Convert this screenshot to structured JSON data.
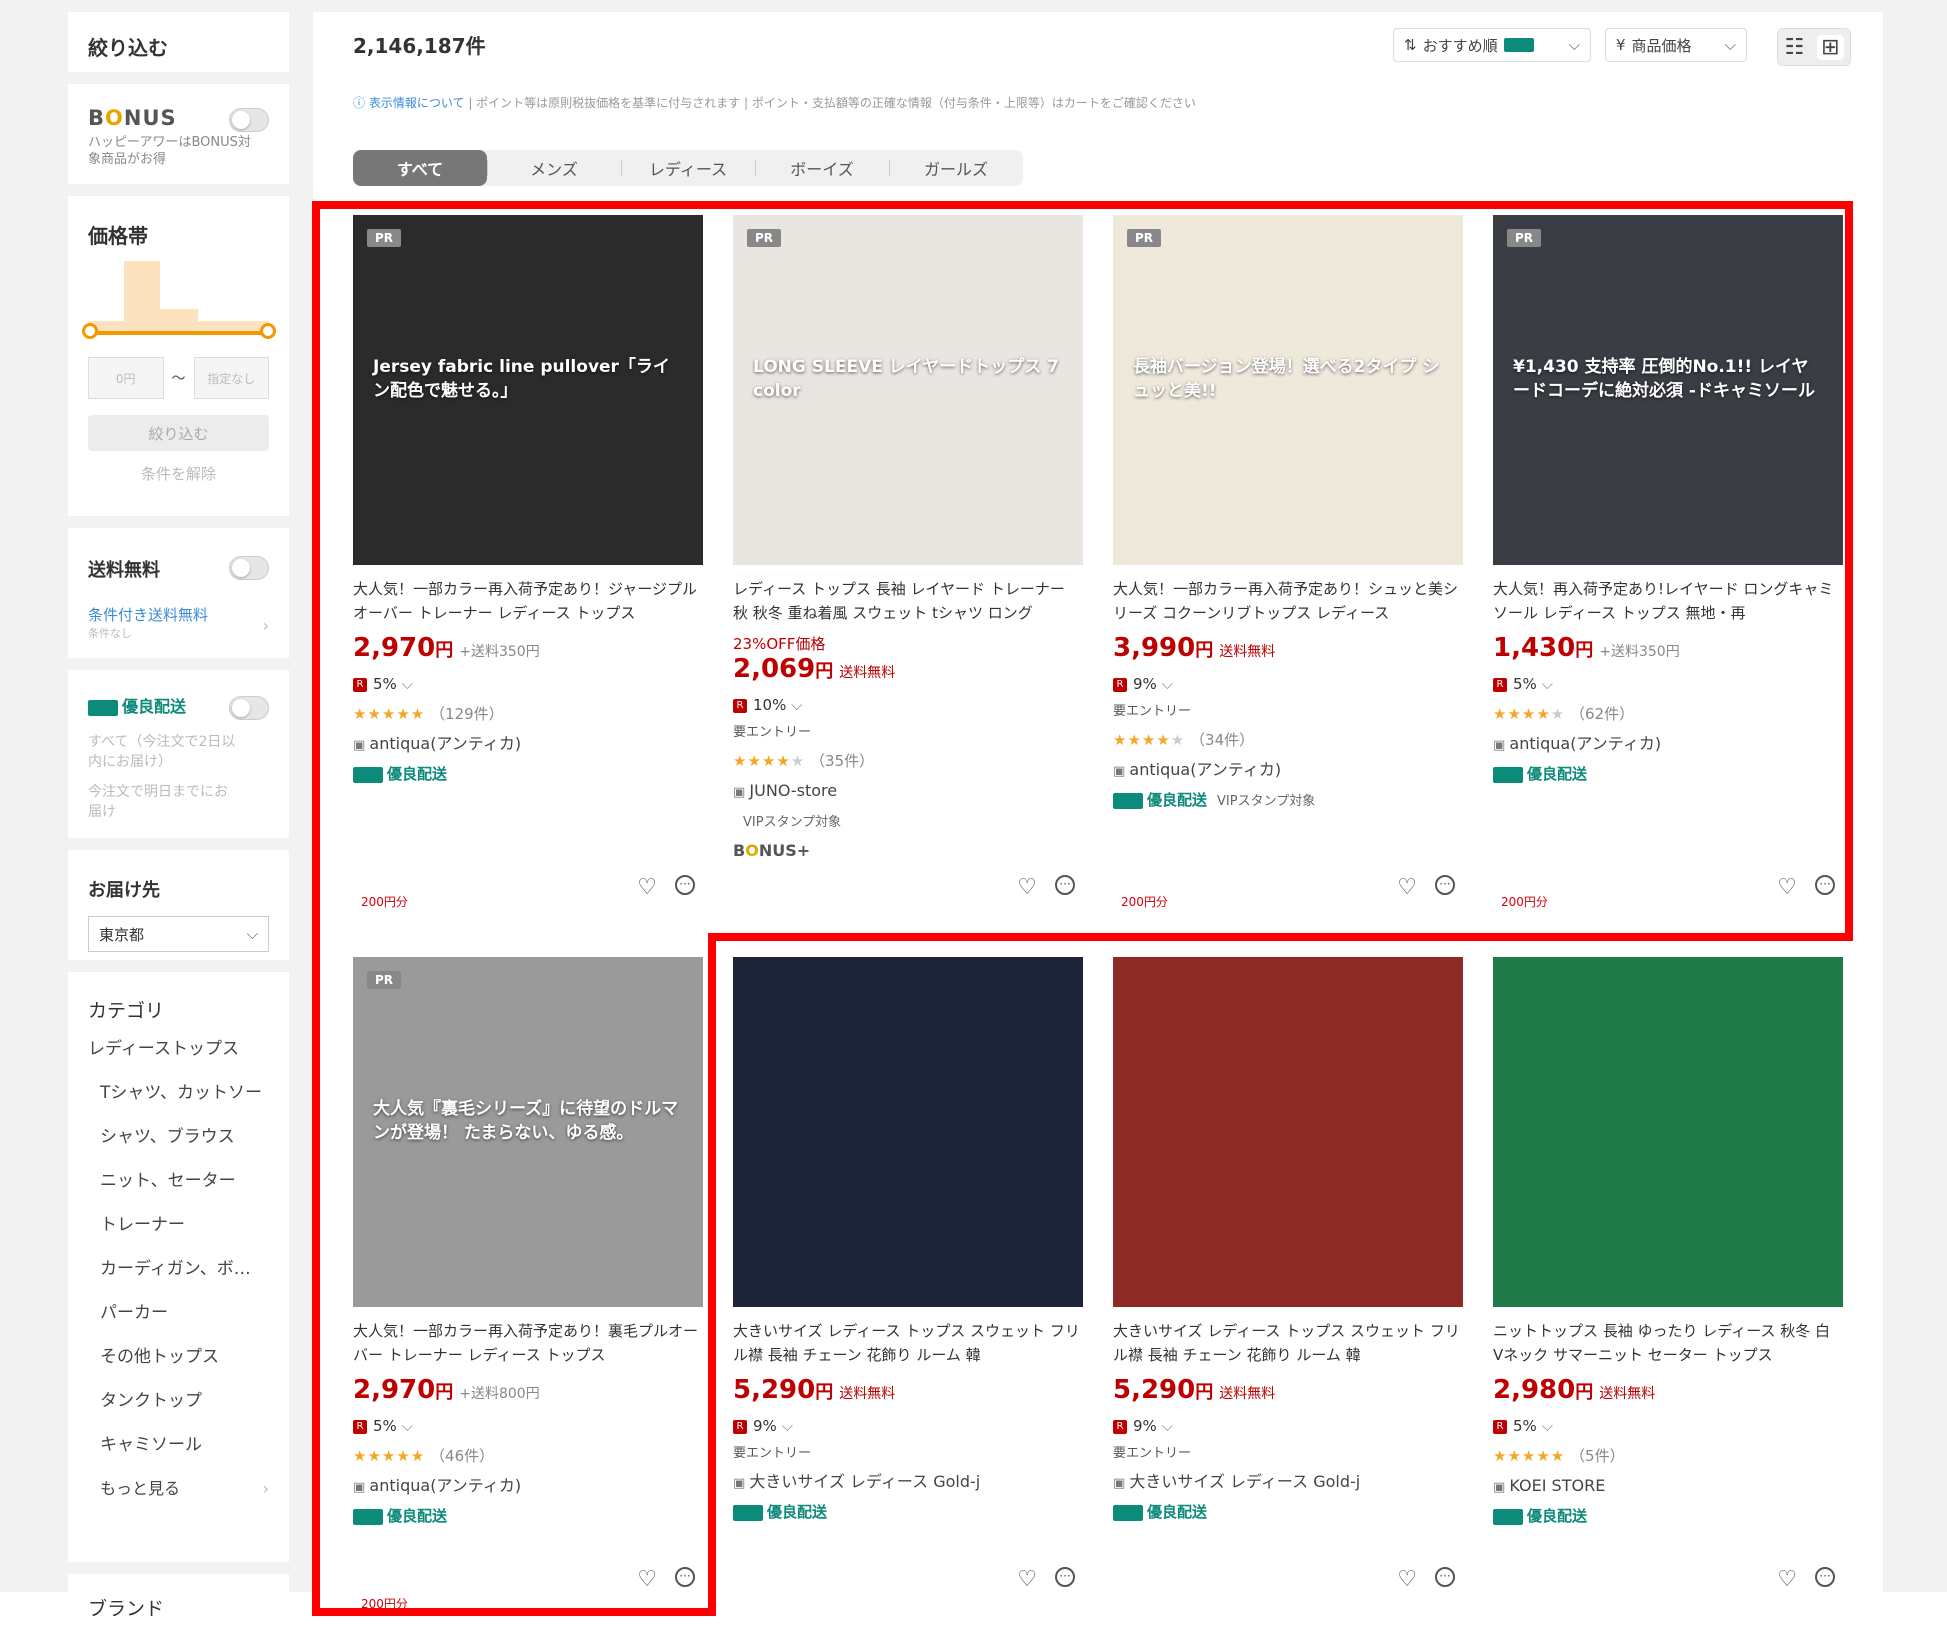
{
  "sidebar": {
    "filter_title": "絞り込む",
    "bonus": {
      "logo_pre": "B",
      "logo_o": "O",
      "logo_post": "NUS",
      "desc": "ハッピーアワーはBONUS対象商品がお得"
    },
    "price": {
      "title": "価格帯",
      "min_placeholder": "0円",
      "max_placeholder": "指定なし",
      "separator": "〜",
      "apply_label": "絞り込む",
      "clear_label": "条件を解除"
    },
    "free_shipping": {
      "title": "送料無料",
      "conditional_label": "条件付き送料無料",
      "conditional_sub": "条件なし"
    },
    "yuryo": {
      "title": "優良配送",
      "line1": "すべて（今注文で2日以内にお届け）",
      "line2": "今注文で明日までにお届け"
    },
    "delivery": {
      "title": "お届け先",
      "selected": "東京都"
    },
    "category": {
      "title": "カテゴリ",
      "items": [
        "レディーストップス",
        "Tシャツ、カットソー",
        "シャツ、ブラウス",
        "ニット、セーター",
        "トレーナー",
        "カーディガン、ボ…",
        "パーカー",
        "その他トップス",
        "タンクトップ",
        "キャミソール"
      ],
      "more_label": "もっと見る"
    },
    "brand_title": "ブランド"
  },
  "main": {
    "count": "2,146,187件",
    "sort_label": "おすすめ順",
    "price_sort_label": "商品価格",
    "price_sort_icon": "¥",
    "info_link": "表示情報について",
    "info_text": "| ポイント等は原則税抜価格を基準に付与されます | ポイント・支払額等の正確な情報（付与条件・上限等）はカートをご確認ください",
    "tabs": [
      "すべて",
      "メンズ",
      "レディース",
      "ボーイズ",
      "ガールズ"
    ]
  },
  "products": [
    {
      "img_text": "Jersey fabric line pullover「ライン配色で魅せる。」",
      "pr": "PR",
      "points_badge": "200円分",
      "title": "大人気！一部カラー再入荷予定あり！ジャージプルオーバー トレーナー レディース トップス",
      "discount": "",
      "price": "2,970",
      "yen": "円",
      "shipping": "+送料350円",
      "points": "5%",
      "entry": "",
      "stars": 4.5,
      "reviews": "（129件）",
      "shop": "antiqua(アンティカ)",
      "shipping_badge": "優良配送",
      "vip": "",
      "bonus_plus": false
    },
    {
      "img_text": "LONG SLEEVE レイヤードトップス 7 color",
      "pr": "PR",
      "points_badge": "",
      "title": "レディース トップス 長袖 レイヤード トレーナー 秋 秋冬 重ね着風 スウェット tシャツ ロング",
      "discount": "23%OFF価格",
      "price": "2,069",
      "yen": "円",
      "shipping": "送料無料",
      "points": "10%",
      "entry": "要エントリー",
      "stars": 4,
      "reviews": "（35件）",
      "shop": "JUNO-store",
      "shipping_badge": "",
      "vip": "VIPスタンプ対象",
      "bonus_plus": true
    },
    {
      "img_text": "長袖バージョン登場！選べる2タイプ シュッと美!!",
      "pr": "PR",
      "points_badge": "200円分",
      "title": "大人気！一部カラー再入荷予定あり！シュッと美シリーズ コクーンリブトップス レディース",
      "discount": "",
      "price": "3,990",
      "yen": "円",
      "shipping": "送料無料",
      "points": "9%",
      "entry": "要エントリー",
      "stars": 3.5,
      "reviews": "（34件）",
      "shop": "antiqua(アンティカ)",
      "shipping_badge": "優良配送",
      "vip": "VIPスタンプ対象",
      "bonus_plus": false
    },
    {
      "img_text": "¥1,430 支持率 圧倒的No.1!! レイヤードコーデに絶対必須 -ドキャミソール",
      "pr": "PR",
      "points_badge": "200円分",
      "title": "大人気！再入荷予定あり!レイヤード ロングキャミソール レディース トップス 無地・再",
      "discount": "",
      "price": "1,430",
      "yen": "円",
      "shipping": "+送料350円",
      "points": "5%",
      "entry": "",
      "stars": 4,
      "reviews": "（62件）",
      "shop": "antiqua(アンティカ)",
      "shipping_badge": "優良配送",
      "vip": "",
      "bonus_plus": false
    },
    {
      "img_text": "大人気『裏毛シリーズ』に待望のドルマンが登場！ たまらない、ゆる感。",
      "pr": "PR",
      "points_badge": "200円分",
      "title": "大人気！一部カラー再入荷予定あり！裏毛プルオーバー トレーナー レディース トップス",
      "discount": "",
      "price": "2,970",
      "yen": "円",
      "shipping": "+送料800円",
      "points": "5%",
      "entry": "",
      "stars": 4.5,
      "reviews": "（46件）",
      "shop": "antiqua(アンティカ)",
      "shipping_badge": "優良配送",
      "vip": "",
      "bonus_plus": false
    },
    {
      "img_text": "",
      "pr": "",
      "points_badge": "",
      "title": "大きいサイズ レディース トップス スウェット フリル襟 長袖 チェーン 花飾り ルーム 韓",
      "discount": "",
      "price": "5,290",
      "yen": "円",
      "shipping": "送料無料",
      "points": "9%",
      "entry": "要エントリー",
      "stars": 0,
      "reviews": "",
      "shop": "大きいサイズ レディース Gold-j",
      "shipping_badge": "優良配送",
      "vip": "",
      "bonus_plus": false
    },
    {
      "img_text": "",
      "pr": "",
      "points_badge": "",
      "title": "大きいサイズ レディース トップス スウェット フリル襟 長袖 チェーン 花飾り ルーム 韓",
      "discount": "",
      "price": "5,290",
      "yen": "円",
      "shipping": "送料無料",
      "points": "9%",
      "entry": "要エントリー",
      "stars": 0,
      "reviews": "",
      "shop": "大きいサイズ レディース Gold-j",
      "shipping_badge": "優良配送",
      "vip": "",
      "bonus_plus": false
    },
    {
      "img_text": "",
      "pr": "",
      "points_badge": "",
      "title": "ニットトップス 長袖 ゆったり レディース 秋冬 白 Vネック サマーニット セーター トップス",
      "discount": "",
      "price": "2,980",
      "yen": "円",
      "shipping": "送料無料",
      "points": "5%",
      "entry": "",
      "stars": 4.5,
      "reviews": "（5件）",
      "shop": "KOEI STORE",
      "shipping_badge": "優良配送",
      "vip": "",
      "bonus_plus": false
    }
  ],
  "colors": {
    "accent_red": "#bf0000",
    "highlight_red": "#ff0000",
    "price_orange": "#f39800",
    "yuryo_teal": "#0d8b7a",
    "link_blue": "#3c8bd9",
    "product_image_bg": [
      "#2b2b2b",
      "#e9e6e1",
      "#efe9dc",
      "#3a3d44",
      "#9a9a9a",
      "#1f2538",
      "#8e2a26",
      "#1f7a4a"
    ]
  },
  "icons": {
    "heart": "heart-icon",
    "more": "more-icon",
    "truck": "truck-icon",
    "chevron": "chevron-down-icon"
  }
}
